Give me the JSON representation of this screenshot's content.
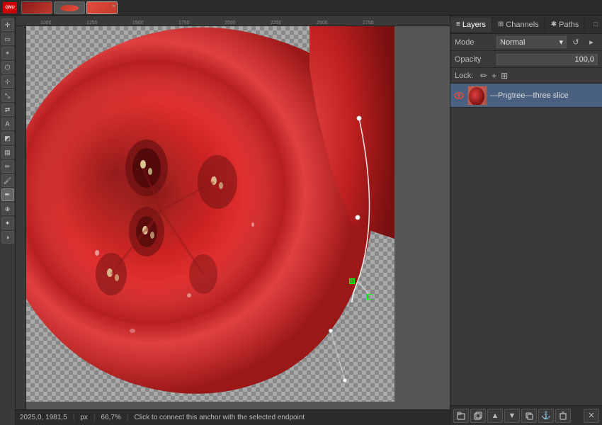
{
  "app": {
    "title": "GIMP",
    "tabs": [
      {
        "label": "tab1",
        "type": "red",
        "active": false
      },
      {
        "label": "tab2",
        "type": "tomato-small",
        "active": false
      },
      {
        "label": "tab3",
        "type": "tomato-main",
        "active": true
      },
      {
        "close": "×"
      }
    ]
  },
  "ruler": {
    "marks": [
      "1000",
      "1250",
      "1500",
      "1750",
      "2000",
      "2250",
      "2500",
      "2750"
    ]
  },
  "canvas": {
    "zoom": "66,7%",
    "coords": "2025,0, 1981,5",
    "unit": "px",
    "status_msg": "Click to connect this anchor with the selected endpoint"
  },
  "right_panel": {
    "tabs": [
      {
        "label": "Layers",
        "icon": "≡",
        "active": true
      },
      {
        "label": "Channels",
        "icon": "⊞"
      },
      {
        "label": "Paths",
        "icon": "✱"
      }
    ],
    "collapse_icon": "□",
    "mode": {
      "label": "Mode",
      "value": "Normal",
      "dropdown_arrow": "▾",
      "icons": [
        "↺",
        "▸"
      ]
    },
    "opacity": {
      "label": "Opacity",
      "value": "100,0",
      "stepper_up": "▲",
      "stepper_down": "▼"
    },
    "lock": {
      "label": "Lock:",
      "icons": [
        "✏",
        "+",
        "⊞"
      ]
    },
    "layers": [
      {
        "name": "—Pngtree—three slice",
        "visible": true,
        "active": true,
        "thumb_color": "#e74c3c"
      }
    ],
    "bottom_tools": [
      "new-group-icon",
      "new-layer-icon",
      "up-icon",
      "down-icon",
      "duplicate-icon",
      "anchor-icon",
      "delete-icon",
      "close-icon"
    ]
  }
}
